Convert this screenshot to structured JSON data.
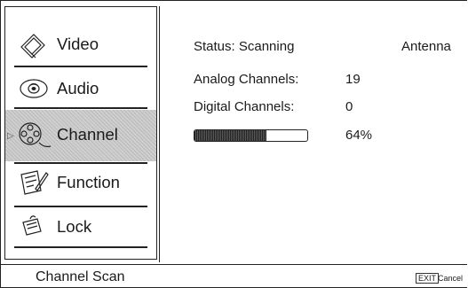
{
  "menu": {
    "items": [
      {
        "label": "Video",
        "icon": "video-icon"
      },
      {
        "label": "Audio",
        "icon": "audio-icon"
      },
      {
        "label": "Channel",
        "icon": "channel-icon",
        "selected": true
      },
      {
        "label": "Function",
        "icon": "function-icon"
      },
      {
        "label": "Lock",
        "icon": "lock-icon"
      }
    ]
  },
  "scan": {
    "status_label": "Status: Scanning",
    "source": "Antenna",
    "analog_label": "Analog Channels:",
    "analog_value": "19",
    "digital_label": "Digital Channels:",
    "digital_value": "0",
    "progress": 0.64,
    "progress_text": "64%"
  },
  "footer": {
    "title": "Channel Scan",
    "exit_key": "EXIT",
    "cancel_label": "Cancel"
  }
}
